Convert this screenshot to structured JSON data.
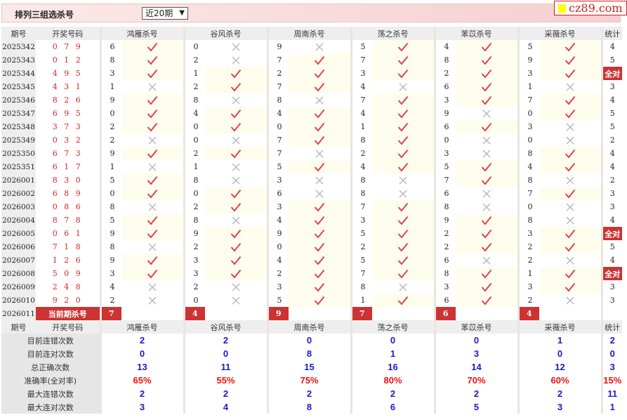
{
  "header": {
    "title": "排列三组选杀号",
    "period_select": "近20期",
    "logo": "cz89.com"
  },
  "columns": {
    "period": "期号",
    "draw": "开奖号码",
    "kills": [
      "鸿雁杀号",
      "谷风杀号",
      "周南杀号",
      "荡之杀号",
      "苯苡杀号",
      "采薇杀号"
    ],
    "stat": "统计"
  },
  "rows": [
    {
      "period": "2025342",
      "draw": "0 7 9",
      "kills": [
        [
          6,
          true
        ],
        [
          0,
          false
        ],
        [
          9,
          false
        ],
        [
          5,
          true
        ],
        [
          4,
          true
        ],
        [
          5,
          true
        ]
      ],
      "stat": "4"
    },
    {
      "period": "2025343",
      "draw": "0 1 2",
      "kills": [
        [
          8,
          true
        ],
        [
          2,
          false
        ],
        [
          7,
          true
        ],
        [
          7,
          true
        ],
        [
          8,
          true
        ],
        [
          9,
          true
        ]
      ],
      "stat": "5"
    },
    {
      "period": "2025344",
      "draw": "4 9 5",
      "kills": [
        [
          3,
          true
        ],
        [
          1,
          true
        ],
        [
          2,
          true
        ],
        [
          3,
          true
        ],
        [
          2,
          true
        ],
        [
          3,
          true
        ]
      ],
      "stat": "全对"
    },
    {
      "period": "2025345",
      "draw": "4 3 1",
      "kills": [
        [
          1,
          false
        ],
        [
          2,
          true
        ],
        [
          7,
          true
        ],
        [
          4,
          false
        ],
        [
          6,
          true
        ],
        [
          1,
          false
        ]
      ],
      "stat": "3"
    },
    {
      "period": "2025346",
      "draw": "8 2 6",
      "kills": [
        [
          9,
          true
        ],
        [
          8,
          false
        ],
        [
          8,
          false
        ],
        [
          7,
          true
        ],
        [
          3,
          true
        ],
        [
          7,
          true
        ]
      ],
      "stat": "4"
    },
    {
      "period": "2025347",
      "draw": "6 9 5",
      "kills": [
        [
          0,
          true
        ],
        [
          4,
          true
        ],
        [
          4,
          true
        ],
        [
          4,
          true
        ],
        [
          9,
          false
        ],
        [
          0,
          true
        ]
      ],
      "stat": "5"
    },
    {
      "period": "2025348",
      "draw": "3 7 3",
      "kills": [
        [
          2,
          true
        ],
        [
          0,
          true
        ],
        [
          0,
          true
        ],
        [
          1,
          true
        ],
        [
          6,
          true
        ],
        [
          3,
          false
        ]
      ],
      "stat": "5"
    },
    {
      "period": "2025349",
      "draw": "0 3 2",
      "kills": [
        [
          2,
          false
        ],
        [
          0,
          false
        ],
        [
          7,
          true
        ],
        [
          8,
          true
        ],
        [
          0,
          false
        ],
        [
          0,
          false
        ]
      ],
      "stat": "2"
    },
    {
      "period": "2025350",
      "draw": "6 7 3",
      "kills": [
        [
          9,
          true
        ],
        [
          2,
          true
        ],
        [
          7,
          false
        ],
        [
          2,
          true
        ],
        [
          3,
          false
        ],
        [
          8,
          true
        ]
      ],
      "stat": "4"
    },
    {
      "period": "2025351",
      "draw": "6 1 7",
      "kills": [
        [
          1,
          false
        ],
        [
          1,
          false
        ],
        [
          5,
          true
        ],
        [
          4,
          true
        ],
        [
          5,
          true
        ],
        [
          4,
          true
        ]
      ],
      "stat": "4"
    },
    {
      "period": "2026001",
      "draw": "8 3 0",
      "kills": [
        [
          5,
          true
        ],
        [
          8,
          false
        ],
        [
          3,
          false
        ],
        [
          8,
          false
        ],
        [
          7,
          true
        ],
        [
          8,
          false
        ]
      ],
      "stat": "2"
    },
    {
      "period": "2026002",
      "draw": "6 8 9",
      "kills": [
        [
          0,
          true
        ],
        [
          0,
          true
        ],
        [
          6,
          false
        ],
        [
          8,
          false
        ],
        [
          6,
          false
        ],
        [
          7,
          true
        ]
      ],
      "stat": "3"
    },
    {
      "period": "2026003",
      "draw": "0 8 6",
      "kills": [
        [
          8,
          false
        ],
        [
          2,
          true
        ],
        [
          3,
          true
        ],
        [
          7,
          true
        ],
        [
          8,
          false
        ],
        [
          0,
          false
        ]
      ],
      "stat": "3"
    },
    {
      "period": "2026004",
      "draw": "8 7 8",
      "kills": [
        [
          5,
          true
        ],
        [
          8,
          false
        ],
        [
          4,
          true
        ],
        [
          3,
          true
        ],
        [
          9,
          true
        ],
        [
          8,
          false
        ]
      ],
      "stat": "4"
    },
    {
      "period": "2026005",
      "draw": "0 6 1",
      "kills": [
        [
          9,
          true
        ],
        [
          9,
          true
        ],
        [
          9,
          true
        ],
        [
          5,
          true
        ],
        [
          2,
          true
        ],
        [
          3,
          true
        ]
      ],
      "stat": "全对"
    },
    {
      "period": "2026006",
      "draw": "7 1 8",
      "kills": [
        [
          8,
          false
        ],
        [
          2,
          true
        ],
        [
          0,
          true
        ],
        [
          2,
          true
        ],
        [
          2,
          true
        ],
        [
          2,
          true
        ]
      ],
      "stat": "5"
    },
    {
      "period": "2026007",
      "draw": "1 2 6",
      "kills": [
        [
          9,
          true
        ],
        [
          3,
          true
        ],
        [
          4,
          true
        ],
        [
          5,
          true
        ],
        [
          6,
          false
        ],
        [
          2,
          false
        ]
      ],
      "stat": "4"
    },
    {
      "period": "2026008",
      "draw": "5 0 9",
      "kills": [
        [
          3,
          true
        ],
        [
          3,
          true
        ],
        [
          2,
          true
        ],
        [
          7,
          true
        ],
        [
          8,
          true
        ],
        [
          1,
          true
        ]
      ],
      "stat": "全对"
    },
    {
      "period": "2026009",
      "draw": "2 4 8",
      "kills": [
        [
          4,
          false
        ],
        [
          2,
          false
        ],
        [
          3,
          true
        ],
        [
          8,
          false
        ],
        [
          3,
          true
        ],
        [
          3,
          true
        ]
      ],
      "stat": "3"
    },
    {
      "period": "2026010",
      "draw": "9 2 0",
      "kills": [
        [
          2,
          false
        ],
        [
          0,
          false
        ],
        [
          5,
          true
        ],
        [
          1,
          true
        ],
        [
          6,
          true
        ],
        [
          2,
          false
        ]
      ],
      "stat": "3"
    }
  ],
  "current": {
    "period": "2026011",
    "label": "当前期杀号",
    "kills": [
      "7",
      "4",
      "9",
      "7",
      "6",
      "4"
    ]
  },
  "stats": [
    {
      "label": "目前连错次数",
      "values": [
        "2",
        "2",
        "0",
        "0",
        "0",
        "1"
      ],
      "stat": "2"
    },
    {
      "label": "目前连对次数",
      "values": [
        "0",
        "0",
        "8",
        "1",
        "3",
        "0"
      ],
      "stat": "0"
    },
    {
      "label": "总正确次数",
      "values": [
        "13",
        "11",
        "15",
        "16",
        "14",
        "12"
      ],
      "stat": "3"
    },
    {
      "label": "准确率(全对率)",
      "values": [
        "65%",
        "55%",
        "75%",
        "80%",
        "70%",
        "60%"
      ],
      "stat": "15%",
      "red": true
    },
    {
      "label": "最大连错次数",
      "values": [
        "2",
        "2",
        "2",
        "2",
        "2",
        "2"
      ],
      "stat": "11"
    },
    {
      "label": "最大连对次数",
      "values": [
        "3",
        "4",
        "8",
        "6",
        "5",
        "3"
      ],
      "stat": "1"
    }
  ],
  "colors": {
    "accent": "#cc3333",
    "hit_bg": "#fffdee",
    "stat_blue": "#1a1acc",
    "rate_red": "#ee1111"
  }
}
